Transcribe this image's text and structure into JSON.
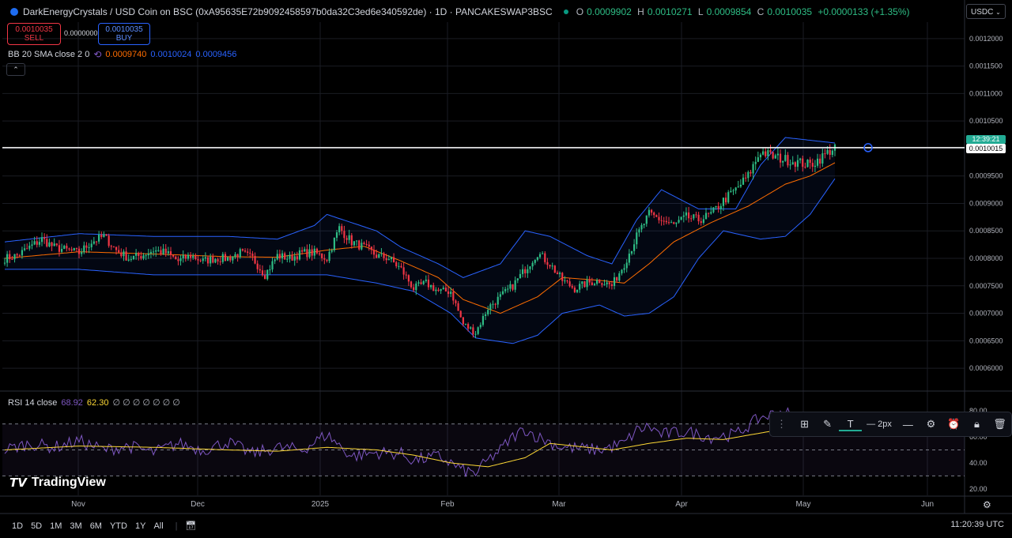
{
  "header": {
    "title": "DarkEnergyCrystals / USD Coin on BSC (0xA95635E72b9092458597b0da32C3ed6e340592de) · 1D · PANCAKESWAP3BSC",
    "ohlc": {
      "o_label": "O",
      "o": "0.0009902",
      "h_label": "H",
      "h": "0.0010271",
      "l_label": "L",
      "l": "0.0009854",
      "c_label": "C",
      "c": "0.0010035",
      "change": "+0.0000133 (+1.35%)"
    }
  },
  "trade": {
    "sell_price": "0.0010035",
    "sell_label": "SELL",
    "spread": "0.0000000",
    "buy_price": "0.0010035",
    "buy_label": "BUY"
  },
  "indicators": {
    "bb_label": "BB 20 SMA close 2 0",
    "bb_basis": "0.0009740",
    "bb_upper": "0.0010024",
    "bb_lower": "0.0009456",
    "rsi_label": "RSI 14 close",
    "rsi_value": "68.92",
    "rsi_ma": "62.30",
    "rsi_extra": "∅ ∅ ∅ ∅ ∅ ∅ ∅",
    "collapse_icon": "chevron-up-icon"
  },
  "price_axis": {
    "currency": "USDC",
    "countdown": "12:39:21",
    "last_price": "0.0010015"
  },
  "toolbar": {
    "width_label": "2px"
  },
  "branding": {
    "name": "TradingView"
  },
  "timeframes": [
    "1D",
    "5D",
    "1M",
    "3M",
    "6M",
    "YTD",
    "1Y",
    "All"
  ],
  "clock": "11:20:39 UTC",
  "colors": {
    "bg": "#000000",
    "up": "#2ebd85",
    "down": "#f23645",
    "bb_band": "#2962ff",
    "bb_basis": "#ff6d00",
    "rsi": "#7e57c2",
    "rsi_ma": "#fdd835",
    "last_line": "#ffffff"
  },
  "chart_data": [
    {
      "type": "candlestick",
      "title": "DarkEnergyCrystals / USD Coin on BSC",
      "ylim": [
        0.00058,
        0.00123
      ],
      "x_ticks": [
        "Nov",
        "Dec",
        "2025",
        "Feb",
        "Mar",
        "Apr",
        "May",
        "Jun"
      ],
      "y_ticks": [
        "0.0012000",
        "0.0011500",
        "0.0011000",
        "0.0010500",
        "0.0010000",
        "0.0009500",
        "0.0009000",
        "0.0008500",
        "0.0008000",
        "0.0007500",
        "0.0007000",
        "0.0006500",
        "0.0006000"
      ],
      "y_tick_values": [
        0.0012,
        0.00115,
        0.0011,
        0.00105,
        0.001,
        0.00095,
        0.0009,
        0.00085,
        0.0008,
        0.00075,
        0.0007,
        0.00065,
        0.0006
      ],
      "close_anchors": [
        [
          0,
          0.0008
        ],
        [
          5,
          0.000805
        ],
        [
          10,
          0.00082
        ],
        [
          15,
          0.000835
        ],
        [
          20,
          0.00082
        ],
        [
          25,
          0.000815
        ],
        [
          30,
          0.00081
        ],
        [
          35,
          0.00083
        ],
        [
          40,
          0.00084
        ],
        [
          45,
          0.000815
        ],
        [
          50,
          0.0008
        ],
        [
          55,
          0.000805
        ],
        [
          60,
          0.000815
        ],
        [
          65,
          0.00081
        ],
        [
          70,
          0.000795
        ],
        [
          75,
          0.000805
        ],
        [
          80,
          0.000795
        ],
        [
          85,
          0.0008
        ],
        [
          90,
          0.0008
        ],
        [
          95,
          0.00081
        ],
        [
          100,
          0.0008
        ],
        [
          105,
          0.00077
        ],
        [
          110,
          0.000805
        ],
        [
          115,
          0.0008
        ],
        [
          120,
          0.00081
        ],
        [
          125,
          0.00081
        ],
        [
          130,
          0.0008
        ],
        [
          135,
          0.000855
        ],
        [
          140,
          0.00083
        ],
        [
          145,
          0.00082
        ],
        [
          150,
          0.000805
        ],
        [
          155,
          0.0008
        ],
        [
          160,
          0.00078
        ],
        [
          165,
          0.000745
        ],
        [
          170,
          0.000755
        ],
        [
          175,
          0.00074
        ],
        [
          180,
          0.00074
        ],
        [
          185,
          0.00068
        ],
        [
          190,
          0.000665
        ],
        [
          195,
          0.00071
        ],
        [
          200,
          0.00073
        ],
        [
          205,
          0.00075
        ],
        [
          210,
          0.00078
        ],
        [
          215,
          0.00081
        ],
        [
          220,
          0.00079
        ],
        [
          225,
          0.00076
        ],
        [
          230,
          0.000745
        ],
        [
          235,
          0.000755
        ],
        [
          240,
          0.00076
        ],
        [
          245,
          0.00075
        ],
        [
          250,
          0.00079
        ],
        [
          255,
          0.00084
        ],
        [
          260,
          0.00088
        ],
        [
          265,
          0.00087
        ],
        [
          270,
          0.00086
        ],
        [
          275,
          0.000875
        ],
        [
          280,
          0.00087
        ],
        [
          285,
          0.00088
        ],
        [
          290,
          0.000905
        ],
        [
          295,
          0.000925
        ],
        [
          300,
          0.00095
        ],
        [
          305,
          0.000995
        ],
        [
          310,
          0.000985
        ],
        [
          315,
          0.00098
        ],
        [
          320,
          0.000975
        ],
        [
          325,
          0.00097
        ],
        [
          330,
          0.000985
        ],
        [
          335,
          0.001003
        ]
      ],
      "bb_upper_anchors": [
        [
          0,
          0.00083
        ],
        [
          30,
          0.000845
        ],
        [
          60,
          0.00084
        ],
        [
          90,
          0.00084
        ],
        [
          110,
          0.000835
        ],
        [
          125,
          0.00086
        ],
        [
          130,
          0.00088
        ],
        [
          140,
          0.000865
        ],
        [
          150,
          0.00085
        ],
        [
          160,
          0.00082
        ],
        [
          175,
          0.00079
        ],
        [
          185,
          0.000765
        ],
        [
          200,
          0.00079
        ],
        [
          210,
          0.00085
        ],
        [
          220,
          0.00084
        ],
        [
          235,
          0.000805
        ],
        [
          245,
          0.00079
        ],
        [
          255,
          0.00087
        ],
        [
          265,
          0.000925
        ],
        [
          280,
          0.00089
        ],
        [
          295,
          0.00089
        ],
        [
          305,
          0.00097
        ],
        [
          315,
          0.00102
        ],
        [
          335,
          0.00101
        ]
      ],
      "bb_lower_anchors": [
        [
          0,
          0.00078
        ],
        [
          30,
          0.00078
        ],
        [
          60,
          0.00077
        ],
        [
          90,
          0.00077
        ],
        [
          110,
          0.00077
        ],
        [
          130,
          0.00077
        ],
        [
          150,
          0.000755
        ],
        [
          165,
          0.00074
        ],
        [
          180,
          0.0007
        ],
        [
          190,
          0.000655
        ],
        [
          205,
          0.000645
        ],
        [
          215,
          0.00066
        ],
        [
          225,
          0.0007
        ],
        [
          240,
          0.000715
        ],
        [
          250,
          0.000695
        ],
        [
          260,
          0.0007
        ],
        [
          270,
          0.00073
        ],
        [
          280,
          0.0008
        ],
        [
          290,
          0.00085
        ],
        [
          305,
          0.000835
        ],
        [
          315,
          0.00084
        ],
        [
          325,
          0.00088
        ],
        [
          335,
          0.000945
        ]
      ],
      "bb_basis_anchors": [
        [
          0,
          0.0008
        ],
        [
          30,
          0.000812
        ],
        [
          60,
          0.000808
        ],
        [
          90,
          0.000803
        ],
        [
          110,
          0.000802
        ],
        [
          130,
          0.000815
        ],
        [
          145,
          0.000822
        ],
        [
          160,
          0.000795
        ],
        [
          175,
          0.000765
        ],
        [
          185,
          0.000725
        ],
        [
          200,
          0.0007
        ],
        [
          215,
          0.00073
        ],
        [
          225,
          0.000765
        ],
        [
          240,
          0.00076
        ],
        [
          250,
          0.000755
        ],
        [
          260,
          0.00079
        ],
        [
          270,
          0.00083
        ],
        [
          285,
          0.000865
        ],
        [
          300,
          0.000895
        ],
        [
          315,
          0.000935
        ],
        [
          325,
          0.00095
        ],
        [
          335,
          0.000974
        ]
      ]
    },
    {
      "type": "line",
      "title": "RSI 14 close",
      "ylim": [
        15,
        85
      ],
      "y_ticks": [
        "80.00",
        "60.00",
        "40.00",
        "20.00"
      ],
      "y_tick_values": [
        80,
        60,
        40,
        20
      ],
      "levels": [
        70,
        50,
        30
      ],
      "series": [
        {
          "name": "RSI",
          "values_anchors": [
            [
              0,
              50
            ],
            [
              10,
              55
            ],
            [
              20,
              52
            ],
            [
              30,
              57
            ],
            [
              40,
              50
            ],
            [
              50,
              53
            ],
            [
              60,
              48
            ],
            [
              70,
              55
            ],
            [
              80,
              50
            ],
            [
              90,
              56
            ],
            [
              100,
              47
            ],
            [
              110,
              52
            ],
            [
              120,
              50
            ],
            [
              130,
              62
            ],
            [
              140,
              45
            ],
            [
              150,
              48
            ],
            [
              160,
              47
            ],
            [
              165,
              42
            ],
            [
              175,
              45
            ],
            [
              180,
              40
            ],
            [
              185,
              34
            ],
            [
              190,
              32
            ],
            [
              195,
              42
            ],
            [
              200,
              50
            ],
            [
              205,
              60
            ],
            [
              210,
              66
            ],
            [
              215,
              60
            ],
            [
              225,
              52
            ],
            [
              240,
              50
            ],
            [
              250,
              55
            ],
            [
              255,
              65
            ],
            [
              260,
              68
            ],
            [
              265,
              62
            ],
            [
              275,
              64
            ],
            [
              285,
              60
            ],
            [
              295,
              62
            ],
            [
              305,
              75
            ],
            [
              315,
              80
            ],
            [
              320,
              70
            ],
            [
              330,
              66
            ],
            [
              335,
              69
            ]
          ]
        },
        {
          "name": "RSI MA",
          "values_anchors": [
            [
              0,
              50
            ],
            [
              30,
              53
            ],
            [
              60,
              52
            ],
            [
              90,
              50
            ],
            [
              110,
              49
            ],
            [
              130,
              52
            ],
            [
              150,
              50
            ],
            [
              165,
              46
            ],
            [
              180,
              40
            ],
            [
              195,
              37
            ],
            [
              210,
              44
            ],
            [
              220,
              55
            ],
            [
              230,
              53
            ],
            [
              245,
              50
            ],
            [
              260,
              55
            ],
            [
              275,
              59
            ],
            [
              290,
              58
            ],
            [
              305,
              63
            ],
            [
              320,
              68
            ],
            [
              335,
              62
            ]
          ]
        }
      ]
    }
  ]
}
